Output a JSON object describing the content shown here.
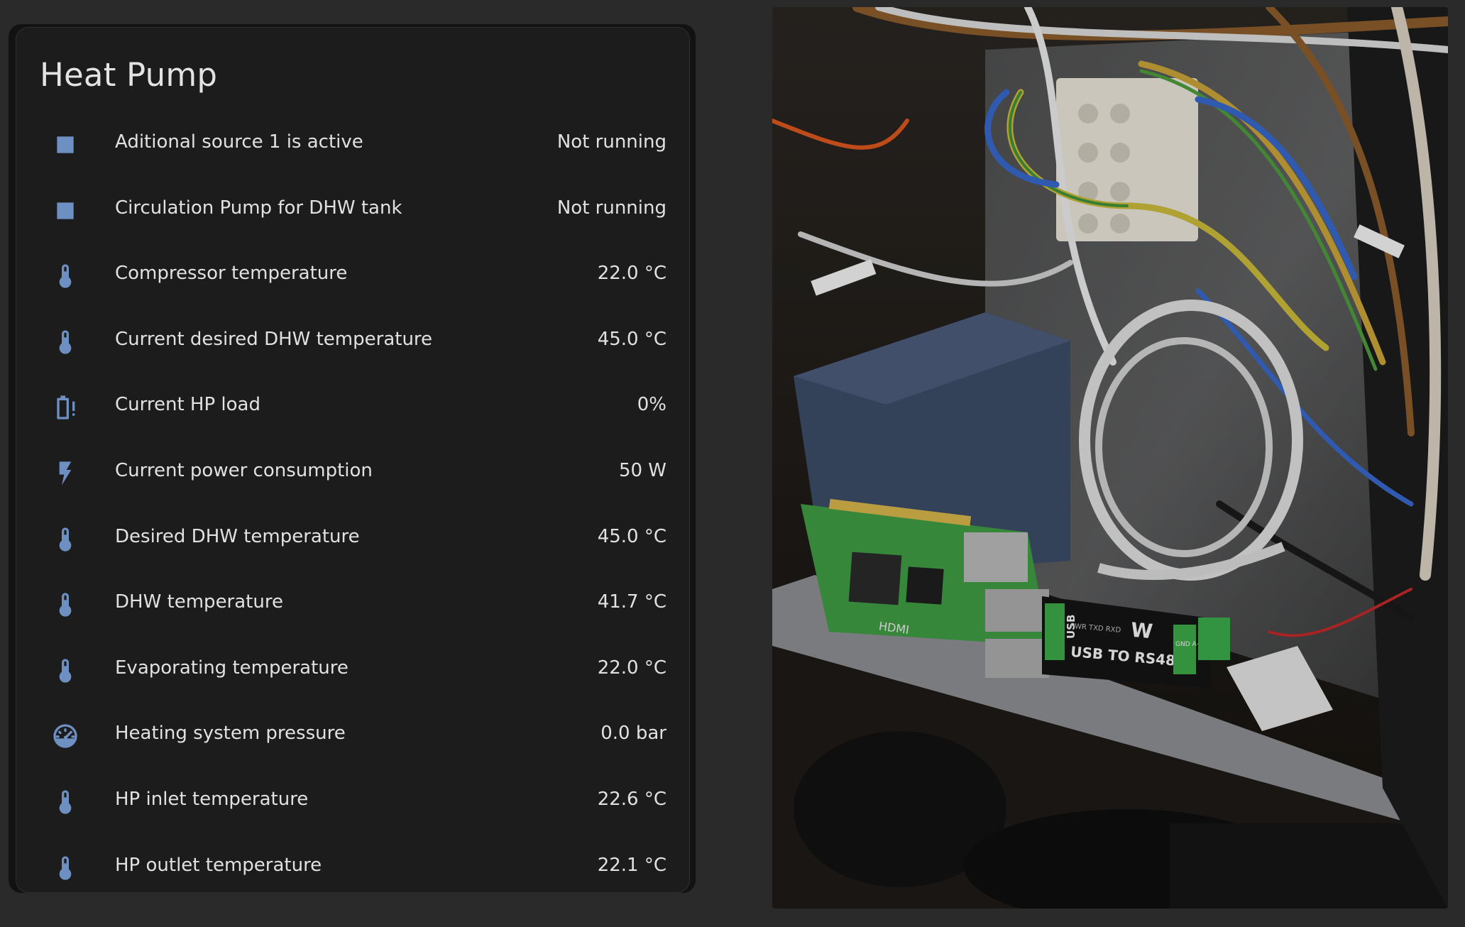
{
  "card": {
    "title": "Heat Pump",
    "icon_color": "#6d8fc2",
    "entities": [
      {
        "icon": "square-icon",
        "name": "Aditional source 1 is active",
        "state": "Not running"
      },
      {
        "icon": "square-icon",
        "name": "Circulation Pump for DHW tank",
        "state": "Not running"
      },
      {
        "icon": "thermometer-icon",
        "name": "Compressor temperature",
        "state": "22.0 °C"
      },
      {
        "icon": "thermometer-icon",
        "name": "Current desired DHW temperature",
        "state": "45.0 °C"
      },
      {
        "icon": "battery-alert-icon",
        "name": "Current HP load",
        "state": "0%"
      },
      {
        "icon": "lightning-bolt-icon",
        "name": "Current power consumption",
        "state": "50 W"
      },
      {
        "icon": "thermometer-icon",
        "name": "Desired DHW temperature",
        "state": "45.0 °C"
      },
      {
        "icon": "thermometer-icon",
        "name": "DHW temperature",
        "state": "41.7 °C"
      },
      {
        "icon": "thermometer-icon",
        "name": "Evaporating temperature",
        "state": "22.0 °C"
      },
      {
        "icon": "gauge-icon",
        "name": "Heating system pressure",
        "state": "0.0 bar"
      },
      {
        "icon": "thermometer-icon",
        "name": "HP inlet temperature",
        "state": "22.6 °C"
      },
      {
        "icon": "thermometer-icon",
        "name": "HP outlet temperature",
        "state": "22.1 °C"
      }
    ]
  },
  "photo": {
    "adapter_label": "USB TO RS485",
    "adapter_usb_text": "USB",
    "adapter_leds": "PWR TXD RXD",
    "adapter_brand": "W",
    "adapter_pins": "GND A+ B-",
    "board_port_label": "HDMI"
  }
}
